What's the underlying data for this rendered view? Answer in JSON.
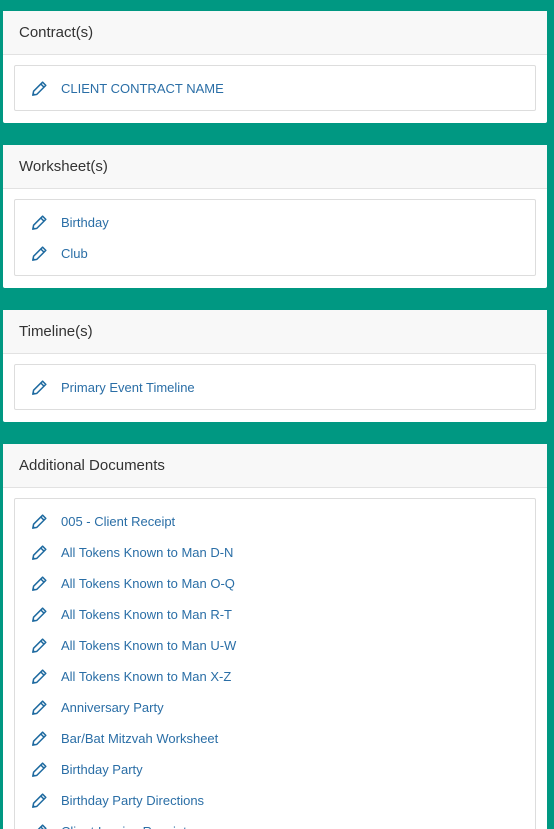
{
  "sections": [
    {
      "title": "Contract(s)",
      "items": [
        {
          "label": "CLIENT CONTRACT NAME",
          "icon": "pencil-icon"
        }
      ]
    },
    {
      "title": "Worksheet(s)",
      "items": [
        {
          "label": "Birthday",
          "icon": "pencil-icon"
        },
        {
          "label": "Club",
          "icon": "pencil-icon"
        }
      ]
    },
    {
      "title": "Timeline(s)",
      "items": [
        {
          "label": "Primary Event Timeline",
          "icon": "pencil-icon"
        }
      ]
    },
    {
      "title": "Additional Documents",
      "items": [
        {
          "label": "005 - Client Receipt",
          "icon": "pencil-icon"
        },
        {
          "label": "All Tokens Known to Man D-N",
          "icon": "pencil-icon"
        },
        {
          "label": "All Tokens Known to Man O-Q",
          "icon": "pencil-icon"
        },
        {
          "label": "All Tokens Known to Man R-T",
          "icon": "pencil-icon"
        },
        {
          "label": "All Tokens Known to Man U-W",
          "icon": "pencil-icon"
        },
        {
          "label": "All Tokens Known to Man X-Z",
          "icon": "pencil-icon"
        },
        {
          "label": "Anniversary Party",
          "icon": "pencil-icon"
        },
        {
          "label": "Bar/Bat Mitzvah Worksheet",
          "icon": "pencil-icon"
        },
        {
          "label": "Birthday Party",
          "icon": "pencil-icon"
        },
        {
          "label": "Birthday Party Directions",
          "icon": "pencil-icon"
        },
        {
          "label": "Client Invoice Receipt",
          "icon": "pencil-icon"
        }
      ]
    }
  ],
  "colors": {
    "background": "#009882",
    "link": "#2a6ea6",
    "icon": "#1e6aa0",
    "header_bg": "#f8f8f8"
  }
}
